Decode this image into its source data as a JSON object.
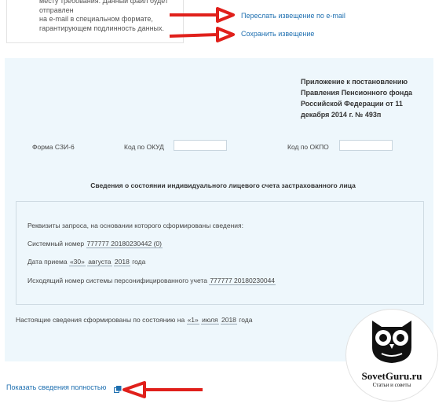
{
  "notice": {
    "lines": [
      "месту требования. Данный файл будет отправлен",
      "на e-mail в специальном формате,",
      "гарантирующем подлинность данных."
    ]
  },
  "links": {
    "resend": "Переслать извещение по e-mail",
    "save": "Сохранить извещение",
    "show_full": "Показать сведения полностью"
  },
  "document": {
    "appendix": [
      "Приложение к постановлению",
      "Правления Пенсионного фонда",
      "Российской Федерации от 11",
      "декабря 2014 г. № 493п"
    ],
    "form_label": "Форма СЗИ-6",
    "okud_label": "Код по ОКУД",
    "okud_value": "",
    "okpo_label": "Код по ОКПО",
    "okpo_value": "",
    "title": "Сведения о состоянии индивидуального лицевого счета застрахованного лица",
    "request_header": "Реквизиты запроса, на основании которого сформированы сведения:",
    "system_number_label": "Системный номер",
    "system_number_value": "777777 20180230442 (0)",
    "receipt_label": "Дата приема",
    "receipt_day": "«30»",
    "receipt_month": "августа",
    "receipt_year": "2018",
    "receipt_suffix": "года",
    "outgoing_label": "Исходящий номер системы персонифицированного учета",
    "outgoing_value": "777777 20180230044",
    "state_label": "Настоящие сведения сформированы по состоянию на",
    "state_day": "«1»",
    "state_month": "июля",
    "state_year": "2018",
    "state_suffix": "года"
  },
  "watermark": {
    "site": "SovetGuru.ru",
    "tagline": "Статьи и советы"
  },
  "colors": {
    "link": "#1e6fb0",
    "doc_background": "#eef7fc",
    "arrow": "#e0201b"
  }
}
